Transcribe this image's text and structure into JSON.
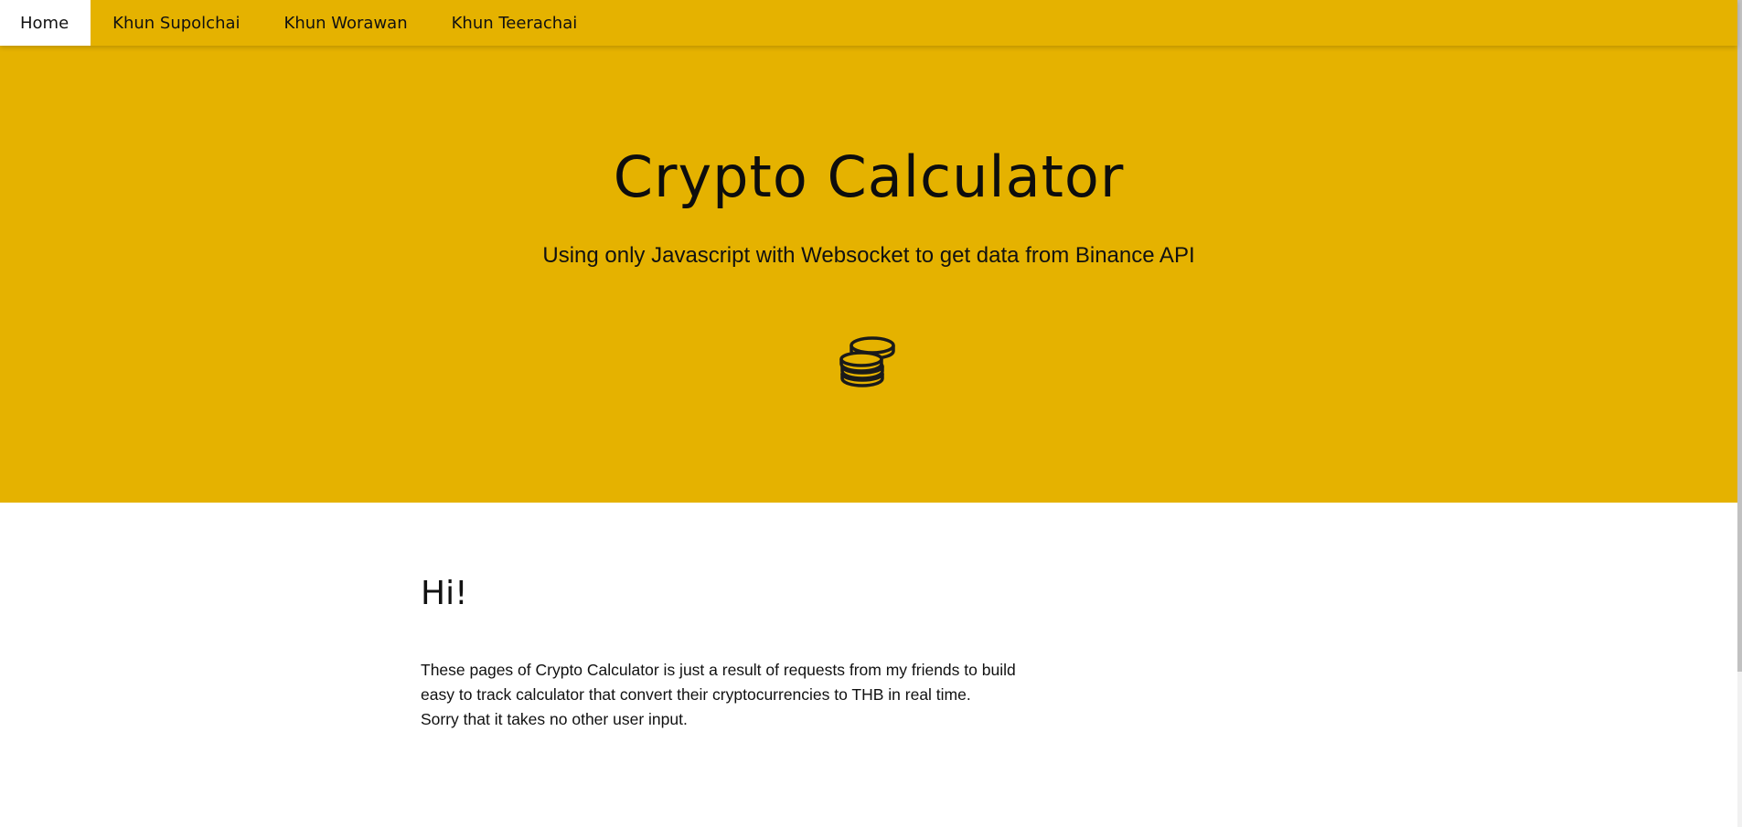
{
  "nav": {
    "items": [
      {
        "label": "Home",
        "active": true
      },
      {
        "label": "Khun Supolchai"
      },
      {
        "label": "Khun Worawan"
      },
      {
        "label": "Khun Teerachai"
      }
    ]
  },
  "hero": {
    "title": "Crypto Calculator",
    "subtitle": "Using only Javascript with Websocket to get data from Binance API",
    "icon": "coins-icon"
  },
  "content": {
    "heading": "Hi!",
    "lines": [
      "These pages of Crypto Calculator is just a result of requests from my friends to build",
      "easy to track calculator that convert their cryptocurrencies to THB in real time.",
      "Sorry that it takes no other user input."
    ]
  },
  "colors": {
    "brand": "#e5b200",
    "text": "#111111",
    "background": "#ffffff"
  }
}
